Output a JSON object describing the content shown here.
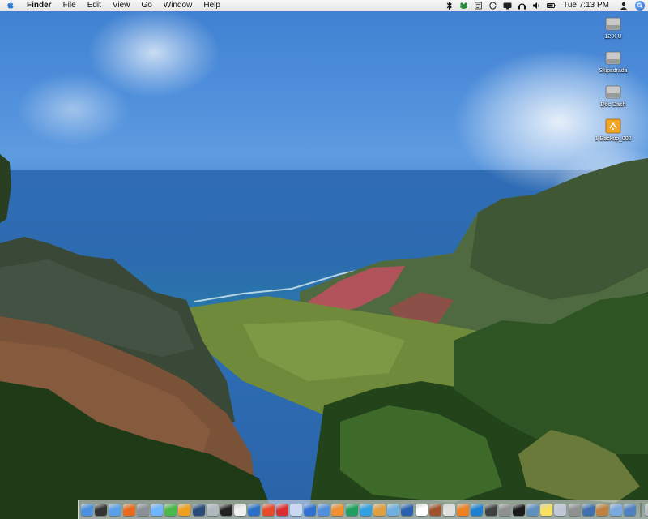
{
  "menubar": {
    "app_name": "Finder",
    "menus": [
      "File",
      "Edit",
      "View",
      "Go",
      "Window",
      "Help"
    ],
    "clock": "Tue 7:13 PM",
    "status_icons": [
      "bluetooth-icon",
      "frog-icon",
      "script-icon",
      "sync-icon",
      "display-icon",
      "headphones-icon",
      "volume-icon",
      "battery-icon"
    ]
  },
  "desktop": {
    "icons": [
      {
        "label": "12 X U",
        "kind": "hard-drive-icon"
      },
      {
        "label": "Skipsdrada",
        "kind": "hard-drive-icon"
      },
      {
        "label": "Doc Dash",
        "kind": "hard-drive-icon"
      },
      {
        "label": "1-Backup_002",
        "kind": "firewire-drive-icon"
      }
    ]
  },
  "dock": {
    "items": [
      {
        "name": "finder",
        "color": "#4a8fe0"
      },
      {
        "name": "dashboard",
        "color": "#333333"
      },
      {
        "name": "safari",
        "color": "#5aa0e8"
      },
      {
        "name": "firefox",
        "color": "#e86a1e"
      },
      {
        "name": "system-preferences",
        "color": "#8a8f98"
      },
      {
        "name": "ichat",
        "color": "#6fb4ff"
      },
      {
        "name": "adium",
        "color": "#4cb84c"
      },
      {
        "name": "ical-sun",
        "color": "#f0a020"
      },
      {
        "name": "network-utility",
        "color": "#2a4a7a"
      },
      {
        "name": "disk-utility",
        "color": "#b0b8c0"
      },
      {
        "name": "terminal",
        "color": "#222222"
      },
      {
        "name": "textedit",
        "color": "#f0f0f0"
      },
      {
        "name": "pencil",
        "color": "#2a70c8"
      },
      {
        "name": "photoshop",
        "color": "#e84a2a"
      },
      {
        "name": "acrobat",
        "color": "#d83030"
      },
      {
        "name": "preview",
        "color": "#c8d8f0"
      },
      {
        "name": "app-store",
        "color": "#3070d0"
      },
      {
        "name": "itunes",
        "color": "#5090e0"
      },
      {
        "name": "illustrator",
        "color": "#f09030"
      },
      {
        "name": "dreamweaver",
        "color": "#20a060"
      },
      {
        "name": "skype",
        "color": "#30a0e0"
      },
      {
        "name": "garageband",
        "color": "#e0a040"
      },
      {
        "name": "iphoto",
        "color": "#70b0e0"
      },
      {
        "name": "quicktime",
        "color": "#2a60b0"
      },
      {
        "name": "ical",
        "color": "#ffffff"
      },
      {
        "name": "address-book",
        "color": "#a0522d"
      },
      {
        "name": "ipod",
        "color": "#e0e0e0"
      },
      {
        "name": "vlc",
        "color": "#f08020"
      },
      {
        "name": "web-browser",
        "color": "#2080d0"
      },
      {
        "name": "activity-monitor",
        "color": "#404040"
      },
      {
        "name": "calculator",
        "color": "#909090"
      },
      {
        "name": "console",
        "color": "#1a1a1a"
      },
      {
        "name": "grapher",
        "color": "#6090c0"
      },
      {
        "name": "stickies",
        "color": "#f8e060"
      },
      {
        "name": "mail",
        "color": "#c0c8d8"
      },
      {
        "name": "printer",
        "color": "#909090"
      },
      {
        "name": "network",
        "color": "#4070b0"
      },
      {
        "name": "installer",
        "color": "#c08040"
      },
      {
        "name": "documents-folder",
        "color": "#7aa8e0"
      },
      {
        "name": "monitor",
        "color": "#5080c0"
      },
      {
        "name": "trash",
        "color": "#b8bcc0"
      }
    ]
  }
}
